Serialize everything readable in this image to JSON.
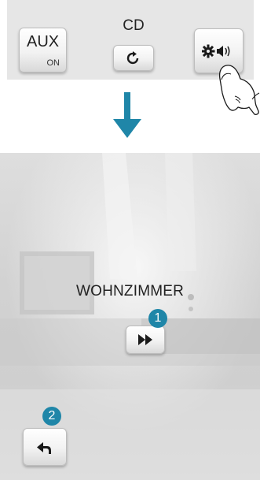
{
  "top_controls": {
    "aux_label": "AUX",
    "aux_state": "ON",
    "cd_label": "CD",
    "cd_icon": "repeat-icon",
    "settings_icon": "gear-speaker-icon"
  },
  "arrow_icon": "arrow-down-icon",
  "room": {
    "title": "WOHNZIMMER",
    "next_icon": "fast-forward-icon",
    "back_icon": "back-arrow-icon",
    "callouts": [
      "1",
      "2"
    ]
  },
  "colors": {
    "arrow": "#1f86a8",
    "badge": "#1f86a8",
    "strip": "#e6e6e6"
  }
}
